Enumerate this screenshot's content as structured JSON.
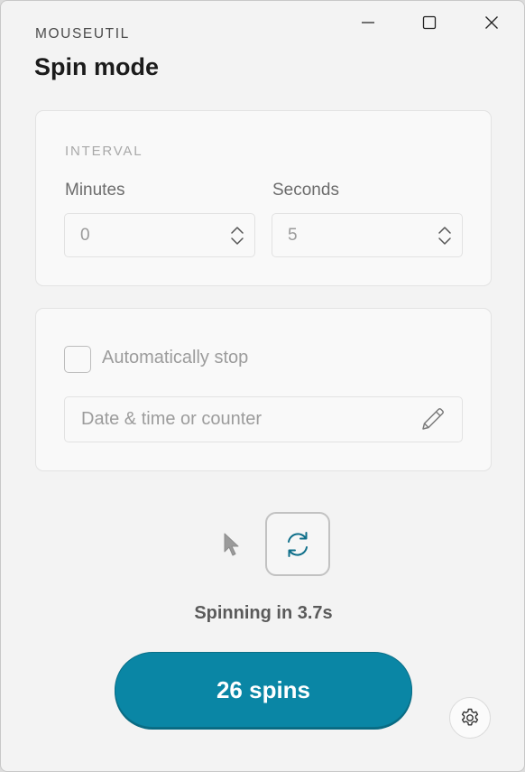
{
  "app": {
    "name": "MOUSEUTIL",
    "page_title": "Spin mode"
  },
  "window_controls": [
    "minimize-icon",
    "maximize-icon",
    "close-icon"
  ],
  "interval": {
    "section_label": "INTERVAL",
    "minutes_label": "Minutes",
    "minutes_value": "0",
    "seconds_label": "Seconds",
    "seconds_value": "5"
  },
  "auto_stop": {
    "checkbox_label": "Automatically stop",
    "checked": false,
    "input_placeholder": "Date & time or counter",
    "input_value": ""
  },
  "actions": {
    "status_text": "Spinning in 3.7s",
    "primary_button_label": "26 spins"
  },
  "colors": {
    "accent": "#0a86a5",
    "refresh_icon": "#0e6f8a"
  },
  "icons": {
    "cursor": "cursor-arrow-icon",
    "refresh": "refresh-icon",
    "edit": "pencil-icon",
    "settings": "gear-icon",
    "stepper": "chevron-up-down-icon"
  }
}
